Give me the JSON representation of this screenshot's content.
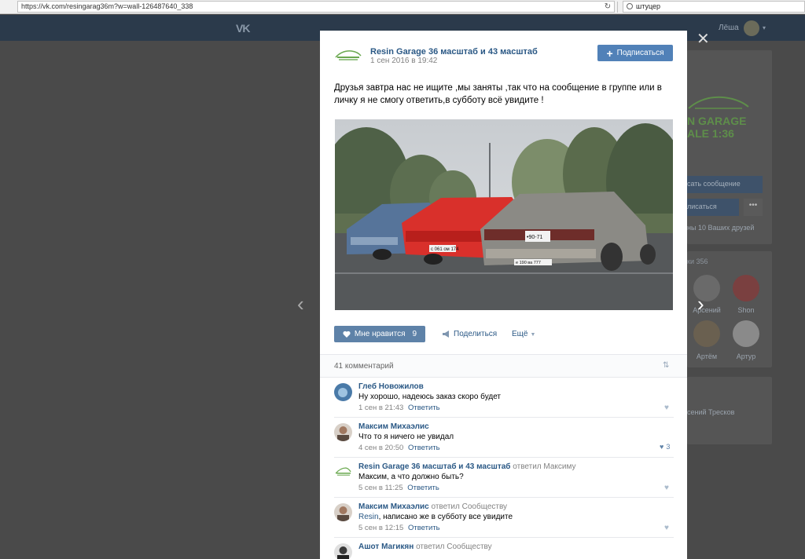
{
  "browser": {
    "url": "https://vk.com/resingarag36m?w=wall-126487640_338",
    "search_query": "штуцер"
  },
  "vk_header": {
    "logo": "VK",
    "username": "Лёша"
  },
  "background_sidebar": {
    "brand_text_line1": "N GARAGE",
    "brand_text_line2": "ALE 1:36",
    "message_button": "сать сообщение",
    "subscribe_button": "лисаться",
    "more_dots": "•••",
    "friends_text": "ны 10 Ваших друзей",
    "subscribers_count": "ки 356",
    "friends": [
      {
        "name": "Арсений"
      },
      {
        "name": "Shon"
      },
      {
        "name": "Артём"
      },
      {
        "name": "Артур"
      }
    ],
    "contact_name": "сений Тресков"
  },
  "post": {
    "group_name": "Resin Garage 36 масштаб и 43 масштаб",
    "date": "1 сен 2016 в 19:42",
    "subscribe_label": "Подписаться",
    "text": "Друзья завтра нас не ищите ,мы заняты ,так что на сообщение в группе или в личку я не смогу ответить,в субботу всё увидите !",
    "plates": [
      "с 061 ом 174",
      "•90-71",
      "е 190 ва 777"
    ],
    "like_label": "Мне нравится",
    "like_count": "9",
    "share_label": "Поделиться",
    "more_label": "Ещё"
  },
  "comments_section": {
    "count_label": "41 комментарий",
    "comments": [
      {
        "author": "Глеб Новожилов",
        "reply_note": "",
        "mention": "",
        "text": "Ну хорошо, надеюсь заказ скоро будет",
        "time": "1 сен в 21:43",
        "reply_label": "Ответить",
        "likes": ""
      },
      {
        "author": "Максим Михаэлис",
        "reply_note": "",
        "mention": "",
        "text": "Что то я ничего не увидал",
        "time": "4 сен в 20:50",
        "reply_label": "Ответить",
        "likes": "3"
      },
      {
        "author": "Resin Garage 36 масштаб и 43 масштаб",
        "reply_note": "ответил Максиму",
        "mention": "",
        "text": "Максим, а что должно быть?",
        "time": "5 сен в 11:25",
        "reply_label": "Ответить",
        "likes": ""
      },
      {
        "author": "Максим Михаэлис",
        "reply_note": "ответил Сообществу",
        "mention": "Resin",
        "text": ", написано же в субботу все увидите",
        "time": "5 сен в 12:15",
        "reply_label": "Ответить",
        "likes": ""
      },
      {
        "author": "Ашот Магикян",
        "reply_note": "ответил Сообществу",
        "mention": "",
        "text": "",
        "time": "",
        "reply_label": "",
        "likes": ""
      }
    ]
  },
  "colors": {
    "vk_blue": "#5181b8",
    "link": "#2a5885",
    "muted": "#828282"
  }
}
